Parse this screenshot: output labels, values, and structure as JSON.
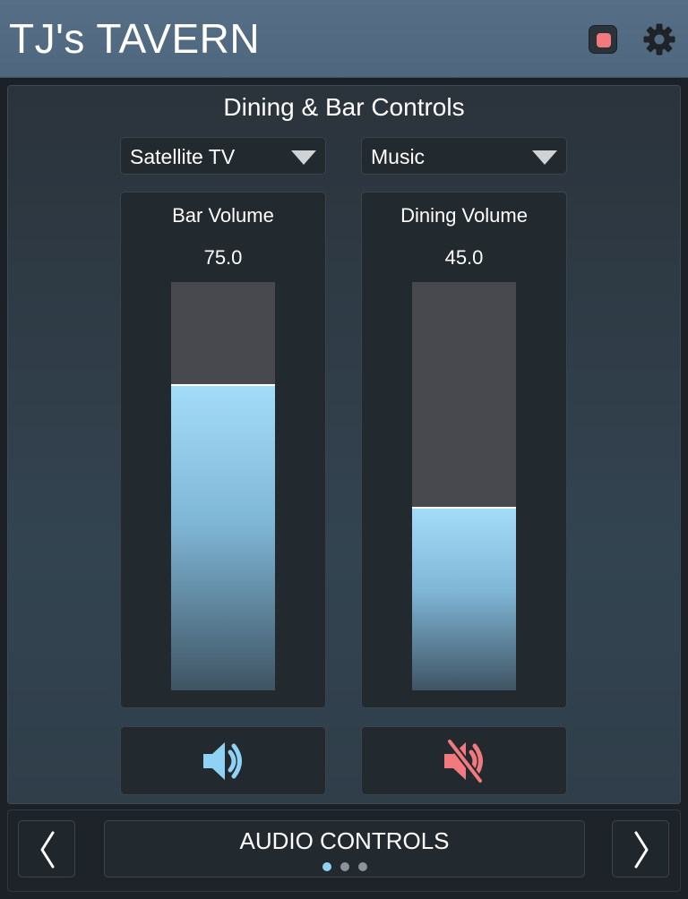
{
  "header": {
    "title": "TJ's TAVERN",
    "stop_icon": "stop-icon",
    "settings_icon": "gear-icon"
  },
  "panel": {
    "title": "Dining & Bar Controls"
  },
  "sources": [
    {
      "zone": "bar",
      "selected": "Satellite TV"
    },
    {
      "zone": "dining",
      "selected": "Music"
    }
  ],
  "zones": [
    {
      "title": "Bar Volume",
      "value": "75.0",
      "level": 0.75,
      "muted": false,
      "mute_icon": "speaker-icon"
    },
    {
      "title": "Dining Volume",
      "value": "45.0",
      "level": 0.45,
      "muted": true,
      "mute_icon": "speaker-muted-icon"
    }
  ],
  "footer": {
    "page_label": "AUDIO CONTROLS",
    "page_count": 3,
    "current_page": 1,
    "prev_icon": "chevron-left-icon",
    "next_icon": "chevron-right-icon"
  },
  "colors": {
    "header": "#526b82",
    "accent": "#8fd2f3",
    "mute_active": "#f27a7e",
    "stop": "#f27a7e"
  }
}
